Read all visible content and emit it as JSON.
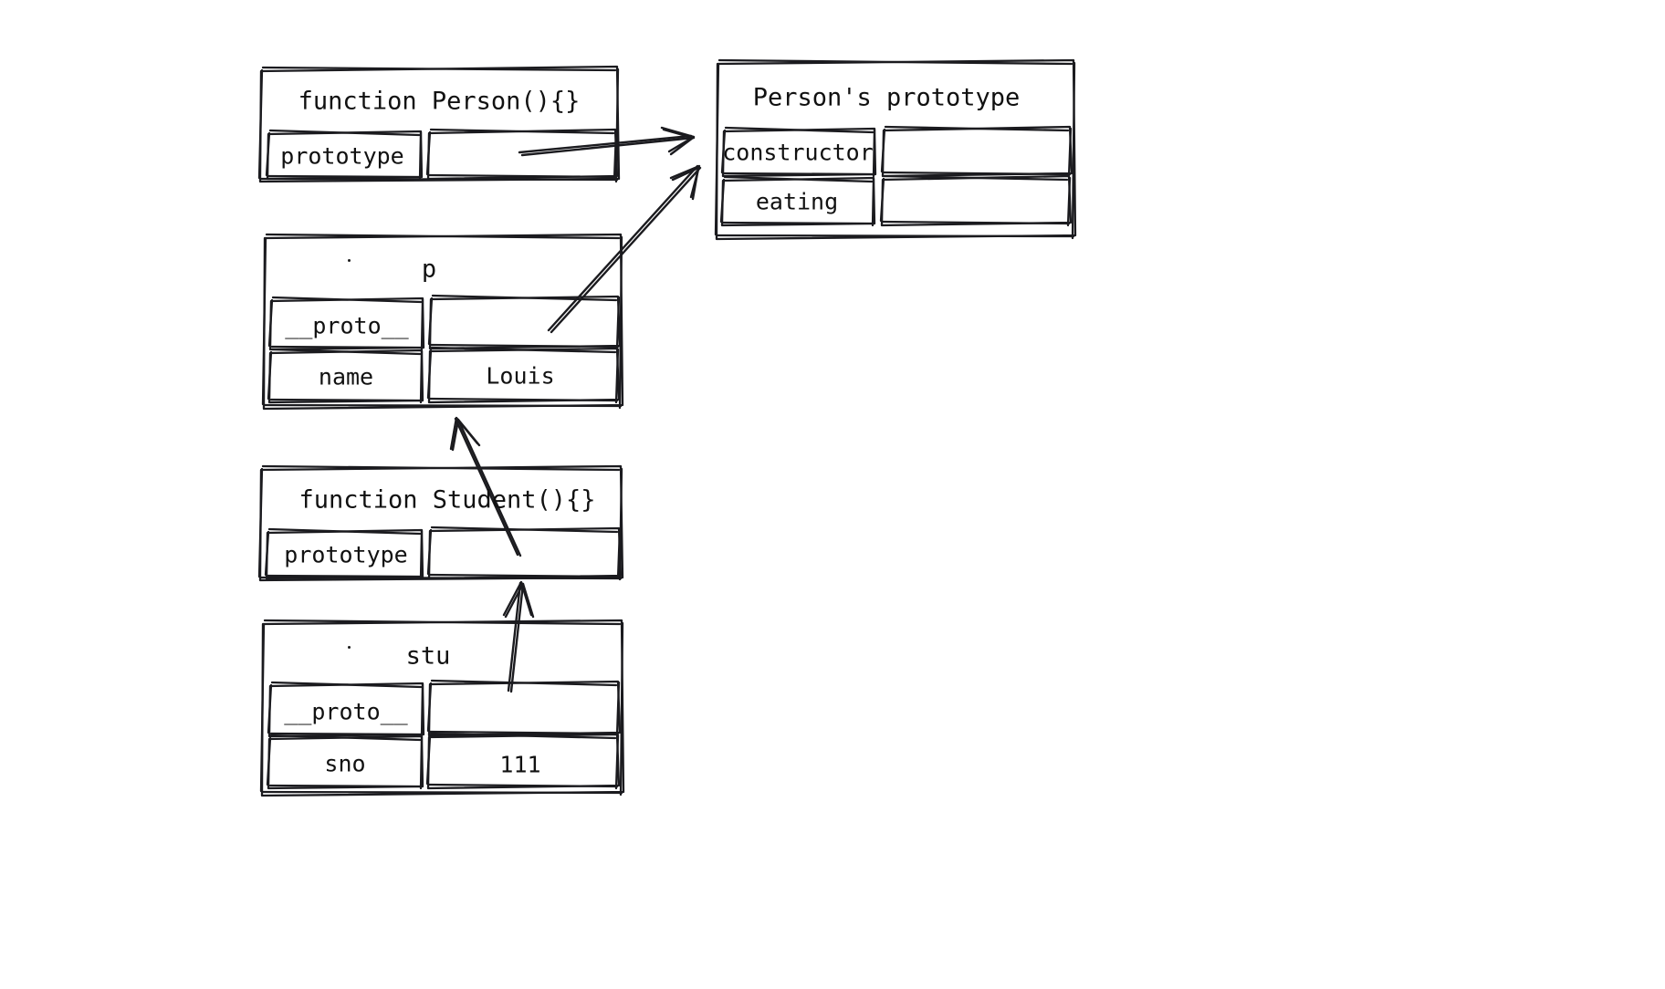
{
  "diagram": {
    "title": "JavaScript prototype chain diagram",
    "style": "hand-drawn sketch",
    "stroke_color": "#1b1b1f",
    "background_color": "#ffffff",
    "boxes": [
      {
        "id": "person-fn",
        "label": "function Person(){}",
        "rows": [
          {
            "key": "prototype",
            "value": ""
          }
        ]
      },
      {
        "id": "person-prototype",
        "label": "Person's prototype",
        "rows": [
          {
            "key": "constructor",
            "value": ""
          },
          {
            "key": "eating",
            "value": ""
          }
        ]
      },
      {
        "id": "p-object",
        "label": "p",
        "rows": [
          {
            "key": "__proto__",
            "value": ""
          },
          {
            "key": "name",
            "value": "Louis"
          }
        ]
      },
      {
        "id": "student-fn",
        "label": "function Student(){}",
        "rows": [
          {
            "key": "prototype",
            "value": ""
          }
        ]
      },
      {
        "id": "stu-object",
        "label": "stu",
        "rows": [
          {
            "key": "__proto__",
            "value": ""
          },
          {
            "key": "sno",
            "value": "111"
          }
        ]
      }
    ],
    "arrows": [
      {
        "id": "person-prototype-arrow",
        "from": "person-fn.prototype",
        "to": "person-prototype"
      },
      {
        "id": "p-proto-arrow",
        "from": "p-object.__proto__",
        "to": "person-prototype"
      },
      {
        "id": "student-prototype-arrow",
        "from": "student-fn.prototype",
        "to": "p-object"
      },
      {
        "id": "stu-proto-arrow",
        "from": "stu-object.__proto__",
        "to": "student-fn.prototype"
      }
    ]
  }
}
